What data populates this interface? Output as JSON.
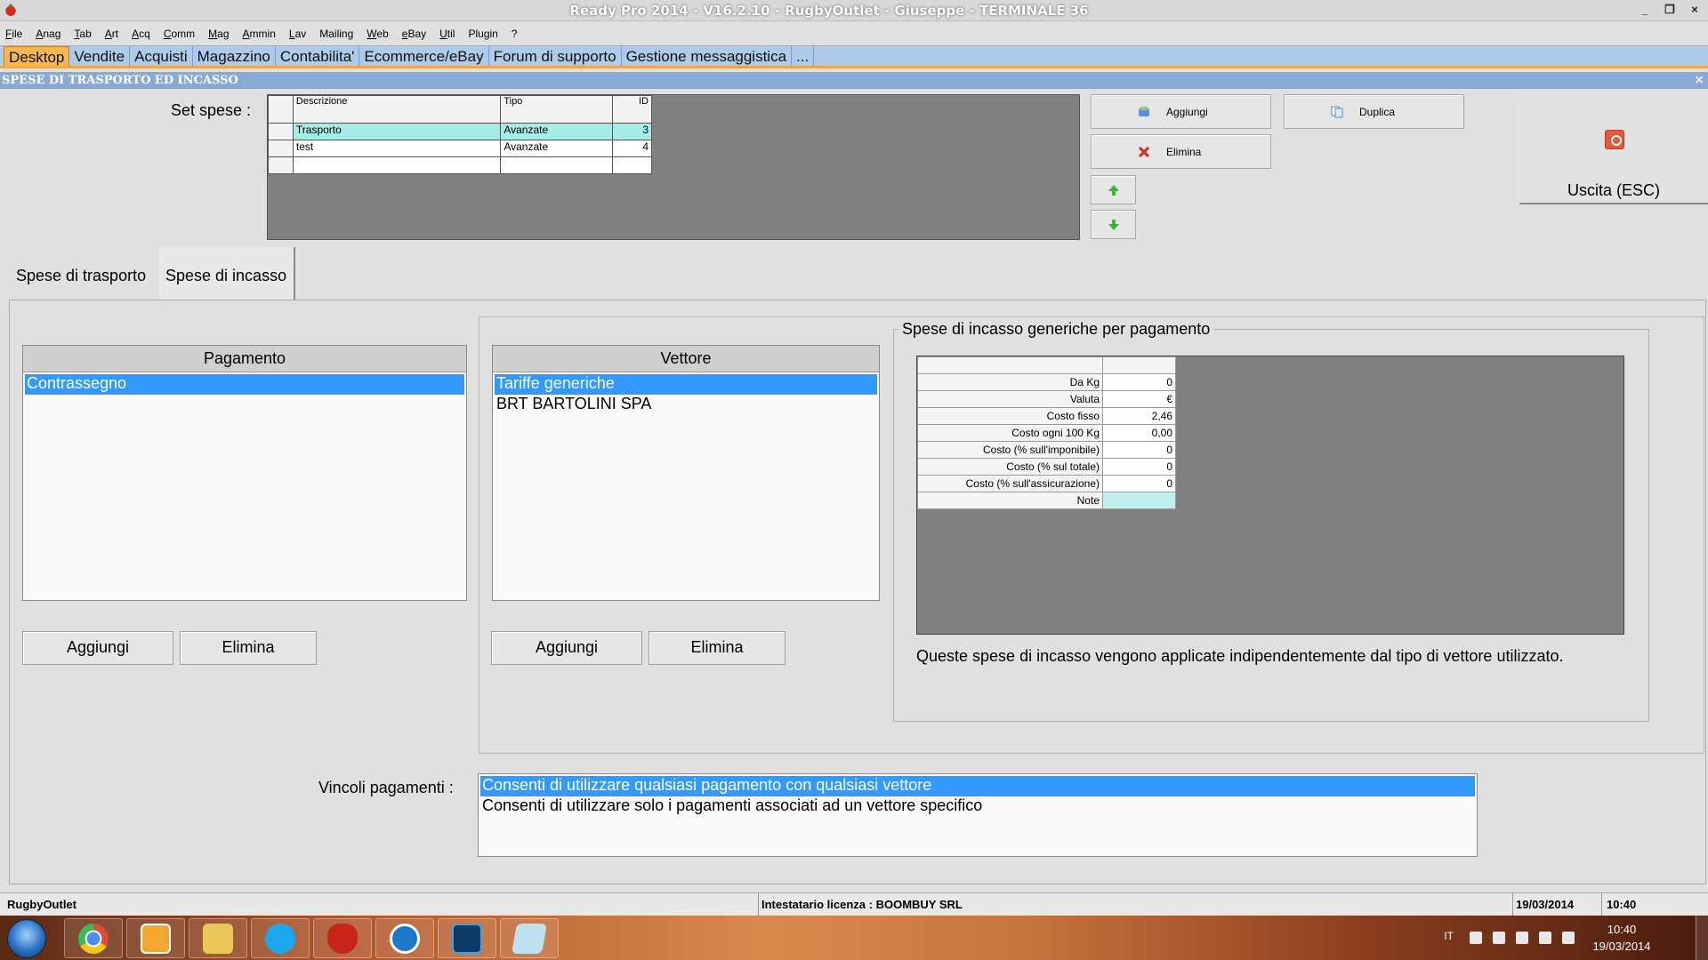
{
  "window": {
    "title": "Ready Pro 2014 - V16.2.10 - RugbyOutlet - Giuseppe - TERMINALE 36",
    "controls": [
      "_",
      "❐",
      "×"
    ]
  },
  "menu": {
    "items": [
      {
        "u": "F",
        "rest": "ile"
      },
      {
        "u": "A",
        "rest": "nag"
      },
      {
        "u": "T",
        "rest": "ab"
      },
      {
        "u": "A",
        "rest": "rt"
      },
      {
        "u": "A",
        "rest": "cq"
      },
      {
        "u": "C",
        "rest": "omm"
      },
      {
        "u": "M",
        "rest": "ag"
      },
      {
        "u": "A",
        "rest": "mmin"
      },
      {
        "u": "L",
        "rest": "av"
      },
      {
        "u": "",
        "rest": "Mailing"
      },
      {
        "u": "W",
        "rest": "eb"
      },
      {
        "u": "e",
        "rest": "Bay"
      },
      {
        "u": "U",
        "rest": "til"
      },
      {
        "u": "",
        "rest": "Plugin"
      },
      {
        "u": "",
        "rest": "?"
      }
    ]
  },
  "tabs": [
    "Desktop",
    "Vendite",
    "Acquisti",
    "Magazzino",
    "Contabilita'",
    "Ecommerce/eBay",
    "Forum di supporto",
    "Gestione messaggistica",
    "..."
  ],
  "section": {
    "title": "SPESE DI TRASPORTO ED INCASSO",
    "close": "×"
  },
  "set_spese": {
    "label": "Set spese :",
    "columns": [
      "Descrizione",
      "Tipo",
      "ID"
    ],
    "rows": [
      {
        "descrizione": "Trasporto",
        "tipo": "Avanzate",
        "id": "3"
      },
      {
        "descrizione": "test",
        "tipo": "Avanzate",
        "id": "4"
      }
    ]
  },
  "buttons": {
    "aggiungi": "Aggiungi",
    "duplica": "Duplica",
    "elimina": "Elimina",
    "uscita": "Uscita (ESC)"
  },
  "inner_tabs": [
    "Spese di trasporto",
    "Spese di incasso"
  ],
  "pagamento": {
    "header": "Pagamento",
    "items": [
      "Contrassegno"
    ],
    "add": "Aggiungi",
    "remove": "Elimina"
  },
  "vettore": {
    "header": "Vettore",
    "items": [
      "Tariffe generiche",
      "BRT BARTOLINI SPA"
    ],
    "add": "Aggiungi",
    "remove": "Elimina"
  },
  "generiche": {
    "legend": "Spese di incasso generiche per pagamento",
    "rows": [
      {
        "k": "Da Kg",
        "v": "0"
      },
      {
        "k": "Valuta",
        "v": "€"
      },
      {
        "k": "Costo fisso",
        "v": "2,46"
      },
      {
        "k": "Costo ogni 100 Kg",
        "v": "0,00"
      },
      {
        "k": "Costo (% sull'imponibile)",
        "v": "0"
      },
      {
        "k": "Costo (% sul totale)",
        "v": "0"
      },
      {
        "k": "Costo (% sull'assicurazione)",
        "v": "0"
      },
      {
        "k": "Note",
        "v": ""
      }
    ],
    "note": "Queste spese di incasso vengono applicate indipendentemente dal tipo di vettore utilizzato."
  },
  "vincoli": {
    "label": "Vincoli pagamenti :",
    "items": [
      "Consenti di utilizzare qualsiasi pagamento con qualsiasi vettore",
      "Consenti di utilizzare solo i pagamenti associati ad un vettore specifico"
    ]
  },
  "status": {
    "company": "RugbyOutlet",
    "license": "Intestatario licenza : BOOMBUY SRL",
    "date": "19/03/2014",
    "time": "10:40"
  },
  "taskbar": {
    "apps": [
      "chrome-icon",
      "outlook-icon",
      "explorer-icon",
      "skype-icon",
      "readypro-icon",
      "teamviewer-icon",
      "photoshop-icon",
      "notes-icon"
    ],
    "lang": "IT",
    "time": "10:40",
    "date": "19/03/2014"
  }
}
